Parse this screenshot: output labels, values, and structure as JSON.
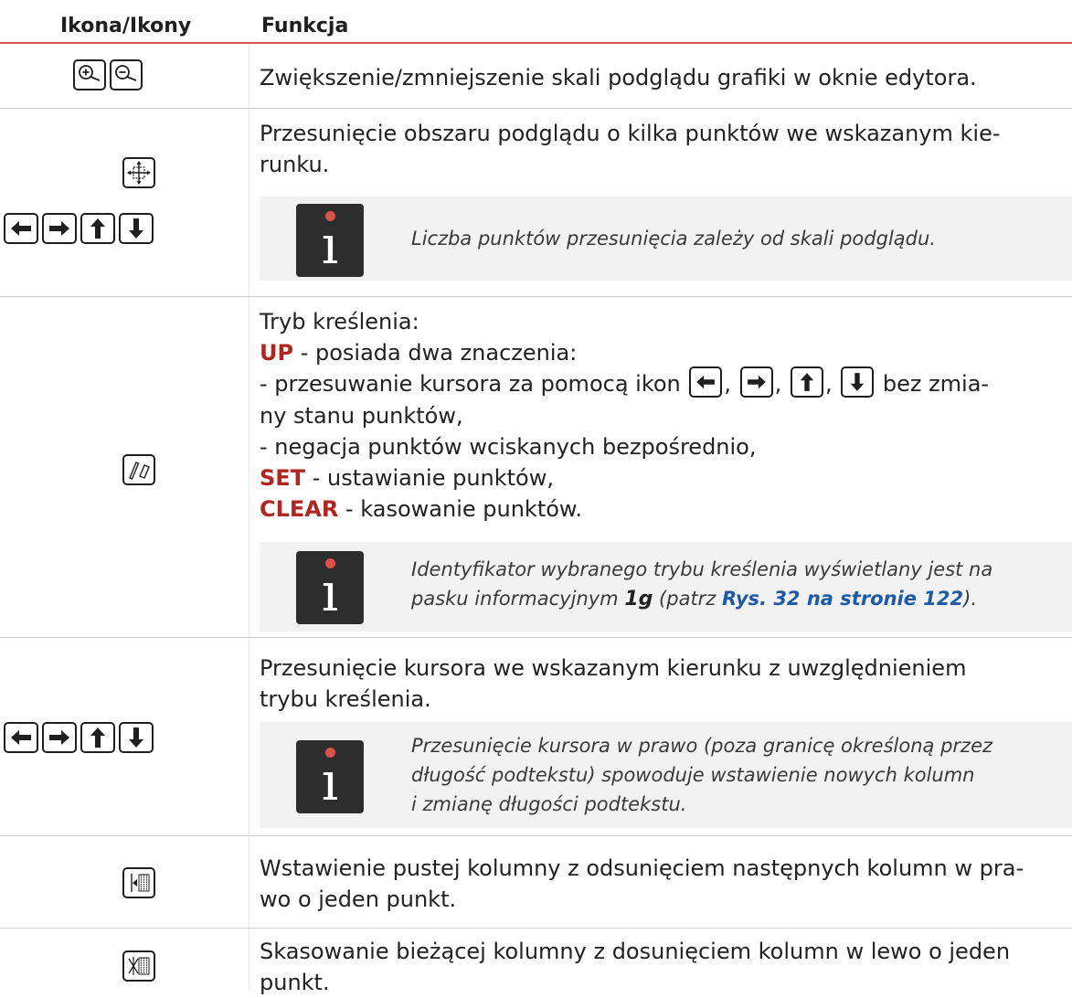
{
  "header": {
    "col_icon": "Ikona/Ikony",
    "col_function": "Funkcja"
  },
  "rows": {
    "zoom": {
      "text": "Zwiększenie/zmniejszenie skali podglądu grafiki w oknie edytora."
    },
    "pan": {
      "text_line1": "Przesunięcie obszaru podglądu o kilka punktów we wskazanym kie-",
      "text_line2": "runku.",
      "note": "Liczba punktów przesunięcia zależy od skali podglądu."
    },
    "draw_mode": {
      "line1": "Tryb kreślenia:",
      "up_kw": "UP",
      "up_desc": " - posiada dwa znaczenia:",
      "move_prefix": "- przesuwanie kursora za pomocą ikon",
      "move_suffix": "bez zmia-",
      "move_line2": "ny stanu punktów,",
      "negate": "- negacja punktów wciskanych bezpośrednio,",
      "set_kw": "SET",
      "set_desc": " - ustawianie punktów,",
      "clear_kw": "CLEAR",
      "clear_desc": " - kasowanie punktów.",
      "note_line1": "Identyfikator wybranego trybu kreślenia wyświetlany jest na",
      "note_line2_prefix": "pasku informacyjnym ",
      "note_ref": "1g",
      "note_mid": " (patrz ",
      "note_link": "Rys. 32 na stronie 122",
      "note_end": ")."
    },
    "cursor": {
      "text_line1": "Przesunięcie kursora we wskazanym kierunku z uwzględnieniem",
      "text_line2": "trybu kreślenia.",
      "note_line1": "Przesunięcie kursora w prawo (poza granicę określoną przez",
      "note_line2": "długość podtekstu) spowoduje wstawienie nowych kolumn",
      "note_line3": "i zmianę długości podtekstu."
    },
    "insert_col": {
      "text_line1": "Wstawienie pustej kolumny z odsunięciem następnych kolumn w pra-",
      "text_line2": "wo o jeden punkt."
    },
    "delete_col": {
      "text_line1": "Skasowanie bieżącej kolumny z dosunięciem kolumn w lewo o jeden",
      "text_line2": "punkt."
    }
  },
  "icons": {
    "zoom_in": "zoom-in-icon",
    "zoom_out": "zoom-out-icon",
    "pan": "pan-move-icon",
    "arrows": [
      "arrow-left-icon",
      "arrow-right-icon",
      "arrow-up-icon",
      "arrow-down-icon"
    ],
    "draw_mode": "draw-mode-icon",
    "insert_column": "insert-column-icon",
    "delete_column": "delete-column-icon",
    "info": "info-icon"
  },
  "colors": {
    "accent_red": "#d9534a",
    "keyword": "#b2261e",
    "link": "#1e5aa6",
    "note_bg": "#f2f2f2"
  }
}
